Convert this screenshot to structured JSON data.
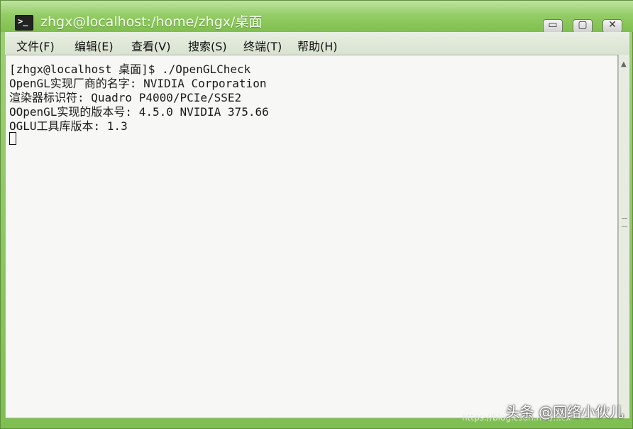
{
  "window": {
    "title": "zhgx@localhost:/home/zhgx/桌面",
    "buttons": {
      "minimize": "▭",
      "maximize": "▢",
      "close": "✕"
    }
  },
  "menu": {
    "items": [
      {
        "label": "文件(F)"
      },
      {
        "label": "编辑(E)"
      },
      {
        "label": "查看(V)"
      },
      {
        "label": "搜索(S)"
      },
      {
        "label": "终端(T)"
      },
      {
        "label": "帮助(H)"
      }
    ]
  },
  "terminal": {
    "lines": [
      "[zhgx@localhost 桌面]$ ./OpenGLCheck",
      "OpenGL实现厂商的名字: NVIDIA Corporation",
      "渲染器标识符: Quadro P4000/PCIe/SSE2",
      "OOpenGL实现的版本号: 4.5.0 NVIDIA 375.66",
      "OGLU工具库版本: 1.3"
    ]
  },
  "watermark": {
    "brand": "头条 @网络小伙儿",
    "url": "https://blog.csdn.net/...cx"
  },
  "icons": {
    "terminal": "terminal-icon",
    "minimize": "minimize-icon",
    "maximize": "maximize-icon",
    "close": "close-icon"
  },
  "colors": {
    "titlebar": "#94cd67",
    "terminal_bg": "#f7f7f5",
    "text": "#1a1a1a"
  }
}
